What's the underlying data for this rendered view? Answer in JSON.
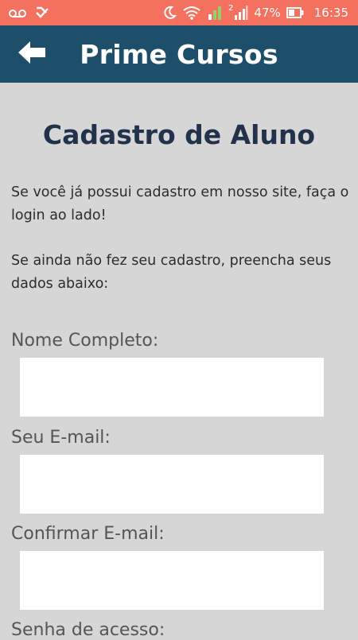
{
  "status_bar": {
    "battery_percent": "47%",
    "time": "16:35",
    "icons": [
      "voicemail-icon",
      "check-icon",
      "moon-icon",
      "wifi-icon",
      "signal-1-icon",
      "signal-2-icon",
      "battery-icon"
    ],
    "sim_label": "2"
  },
  "app_bar": {
    "title": "Prime Cursos",
    "back_icon": "arrow-left-icon",
    "background": "#1d4f6b"
  },
  "page": {
    "title": "Cadastro de Aluno",
    "intro_1": "Se você já possui cadastro em nosso site, faça o login ao lado!",
    "intro_2": "Se ainda não fez seu cadastro, preencha seus dados abaixo:"
  },
  "form": {
    "fields": [
      {
        "label": "Nome Completo:",
        "value": "",
        "placeholder": ""
      },
      {
        "label": "Seu E-mail:",
        "value": "",
        "placeholder": ""
      },
      {
        "label": "Confirmar E-mail:",
        "value": "",
        "placeholder": ""
      },
      {
        "label": "Senha de acesso:",
        "value": "",
        "placeholder": ""
      }
    ]
  },
  "colors": {
    "status_bar": "#f4715f",
    "background": "#d6d6d6",
    "title_text": "#22324b"
  }
}
